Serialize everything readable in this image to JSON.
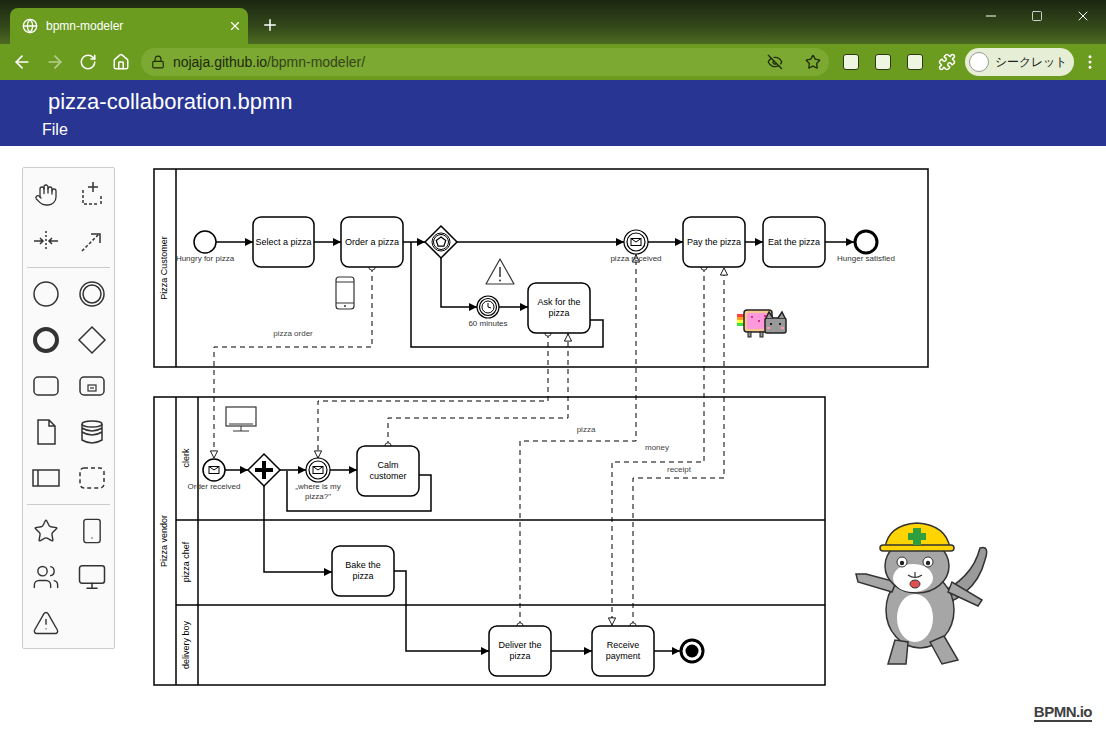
{
  "browser": {
    "tab_title": "bpmn-modeler",
    "url_host": "nojaja.github.io",
    "url_path": "/bpmn-modeler/",
    "profile_label": "シークレット",
    "back_enabled": true,
    "forward_enabled": false
  },
  "app": {
    "title": "pizza-collaboration.bpmn",
    "menu": [
      "File"
    ]
  },
  "diagram": {
    "pools": [
      {
        "name": "Pizza Customer",
        "lanes": []
      },
      {
        "name": "Pizza vendor",
        "lanes": [
          "clerk",
          "pizza chef",
          "delivery boy"
        ]
      }
    ],
    "nodes": [
      {
        "kind": "start-event",
        "label": "Hungry for pizza"
      },
      {
        "kind": "task",
        "label": "Select a pizza"
      },
      {
        "kind": "task",
        "label": "Order a pizza"
      },
      {
        "kind": "event-gateway"
      },
      {
        "kind": "timer-event",
        "label": "60 minutes"
      },
      {
        "kind": "task",
        "label": "Ask for the pizza"
      },
      {
        "kind": "message-event",
        "label": "pizza received"
      },
      {
        "kind": "task",
        "label": "Pay the pizza"
      },
      {
        "kind": "task",
        "label": "Eat the pizza"
      },
      {
        "kind": "end-event",
        "label": "Hunger satisfied"
      },
      {
        "kind": "message-start-event",
        "label": "Order received"
      },
      {
        "kind": "parallel-gateway"
      },
      {
        "kind": "message-event",
        "label": "„where is my pizza?\""
      },
      {
        "kind": "task",
        "label": "Calm customer"
      },
      {
        "kind": "task",
        "label": "Bake the pizza"
      },
      {
        "kind": "task",
        "label": "Deliver the pizza"
      },
      {
        "kind": "task",
        "label": "Receive payment"
      },
      {
        "kind": "terminate-end-event"
      }
    ],
    "message_flow_labels": [
      "pizza order",
      "pizza",
      "money",
      "receipt"
    ]
  },
  "logo": "BPMN.io"
}
